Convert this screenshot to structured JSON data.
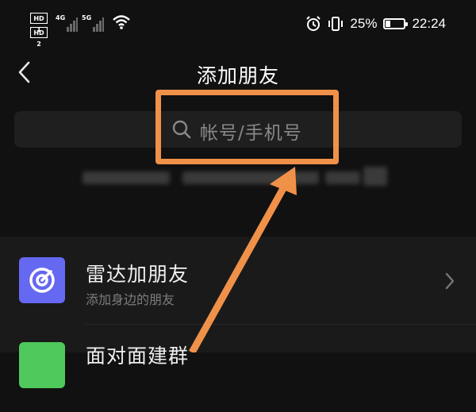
{
  "status_bar": {
    "sim1": "HD 1",
    "sim2": "HD 2",
    "net1": "4G",
    "net2": "5G",
    "battery_percent": "25%",
    "time": "22:24",
    "icons": [
      "alarm-icon",
      "vibrate-icon",
      "battery-charging-icon",
      "wifi-icon",
      "signal-icon"
    ]
  },
  "nav": {
    "title": "添加朋友",
    "back_icon": "back-chevron-icon"
  },
  "search": {
    "placeholder": "帐号/手机号",
    "icon": "search-icon"
  },
  "list": {
    "items": [
      {
        "title": "雷达加朋友",
        "subtitle": "添加身边的朋友",
        "icon": "radar-icon",
        "icon_color": "#6568f0"
      },
      {
        "title": "面对面建群",
        "icon": "group-icon",
        "icon_color": "#4fc95b"
      }
    ]
  },
  "colors": {
    "background": "#111111",
    "annotation": "#f0914a"
  }
}
